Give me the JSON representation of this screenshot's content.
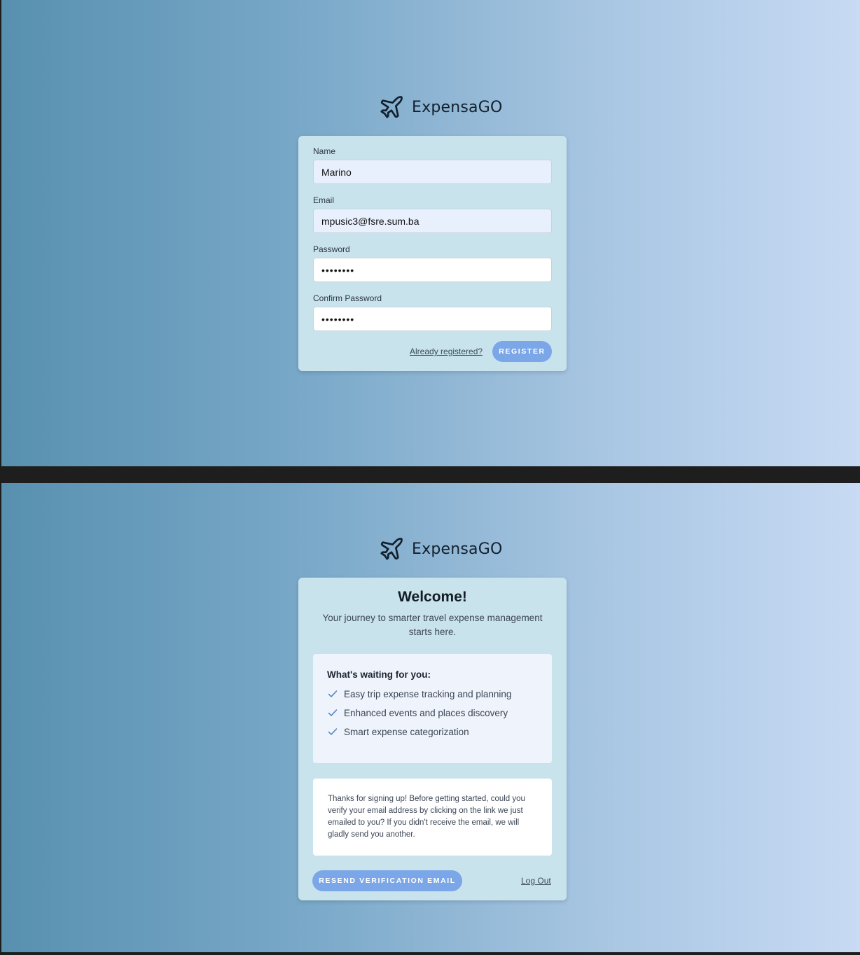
{
  "brand": {
    "name": "ExpensaGO",
    "icon": "airplane-icon"
  },
  "register": {
    "fields": {
      "name": {
        "label": "Name",
        "value": "Marino"
      },
      "email": {
        "label": "Email",
        "value": "mpusic3@fsre.sum.ba"
      },
      "password": {
        "label": "Password",
        "value": "••••••••"
      },
      "confirm_password": {
        "label": "Confirm Password",
        "value": "••••••••"
      }
    },
    "already_registered_link": "Already registered?",
    "register_button": "REGISTER"
  },
  "welcome": {
    "title": "Welcome!",
    "subtitle": "Your journey to smarter travel expense management starts here.",
    "benefits_heading": "What's waiting for you:",
    "benefits": [
      "Easy trip expense tracking and planning",
      "Enhanced events and places discovery",
      "Smart expense categorization"
    ],
    "notice": "Thanks for signing up! Before getting started, could you verify your email address by clicking on the link we just emailed to you? If you didn't receive the email, we will gladly send you another.",
    "resend_button": "RESEND VERIFICATION EMAIL",
    "logout_link": "Log Out"
  },
  "colors": {
    "accent": "#7ba6e8",
    "card": "#c8e3ec",
    "check": "#4a7ec2"
  }
}
